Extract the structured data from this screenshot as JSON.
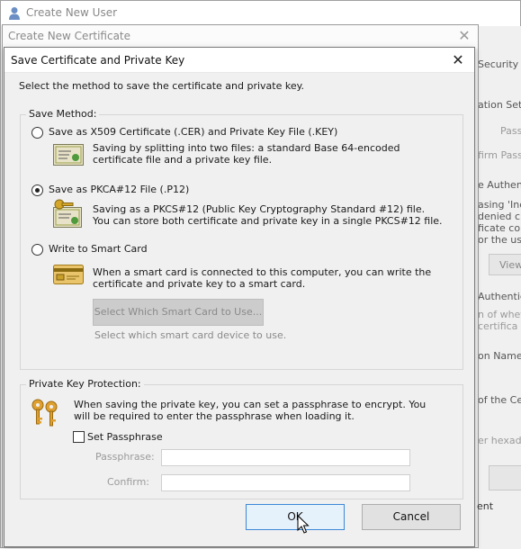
{
  "back_window": {
    "title": "Create New User",
    "right_fragments": [
      "Security Po",
      "ation Set",
      "Passw",
      "firm Passw",
      "e Authent",
      "asing 'Ind",
      "denied c",
      "ficate con",
      "or the use",
      "View",
      "Authentica",
      "n of whet",
      "certifica",
      "on Name",
      "of the Cer",
      "er hexade",
      "ent"
    ]
  },
  "cert_window": {
    "title": "Create New Certificate",
    "close_icon": "close-icon"
  },
  "dialog": {
    "title": "Save Certificate and Private Key",
    "instruction": "Select the method to save the certificate and private key.",
    "save_method_legend": "Save Method:",
    "options": [
      {
        "label": "Save as X509 Certificate (.CER) and Private Key File (.KEY)",
        "description": "Saving by splitting into two files: a standard Base 64-encoded certificate file and a private key file.",
        "selected": false,
        "icon": "certificate-icon"
      },
      {
        "label": "Save as PKCA#12 File (.P12)",
        "description": "Saving as a PKCS#12 (Public Key Cryptography Standard #12) file.\nYou can store both certificate and private key in a single PKCS#12 file.",
        "selected": true,
        "icon": "certificate-key-icon"
      },
      {
        "label": "Write to Smart Card",
        "description": "When a smart card is connected to this computer, you can write the certificate and private key to a smart card.",
        "selected": false,
        "icon": "smart-card-icon"
      }
    ],
    "smart_card_button": "Select Which Smart Card to Use...",
    "smart_card_help": "Select which smart card device to use.",
    "pk_legend": "Private Key Protection:",
    "pk_description": "When saving the private key, you can set a passphrase to encrypt. You will be required to enter the passphrase when loading it.",
    "set_passphrase_label": "Set Passphrase",
    "set_passphrase_checked": false,
    "passphrase_label": "Passphrase:",
    "confirm_label": "Confirm:",
    "passphrase_value": "",
    "confirm_value": "",
    "ok_label": "OK",
    "cancel_label": "Cancel"
  },
  "colors": {
    "window_bg": "#f0f0f0",
    "ok_button_bg": "#e5f1fb",
    "ok_button_border": "#3c87d6",
    "disabled_text": "#8a8a8a"
  }
}
